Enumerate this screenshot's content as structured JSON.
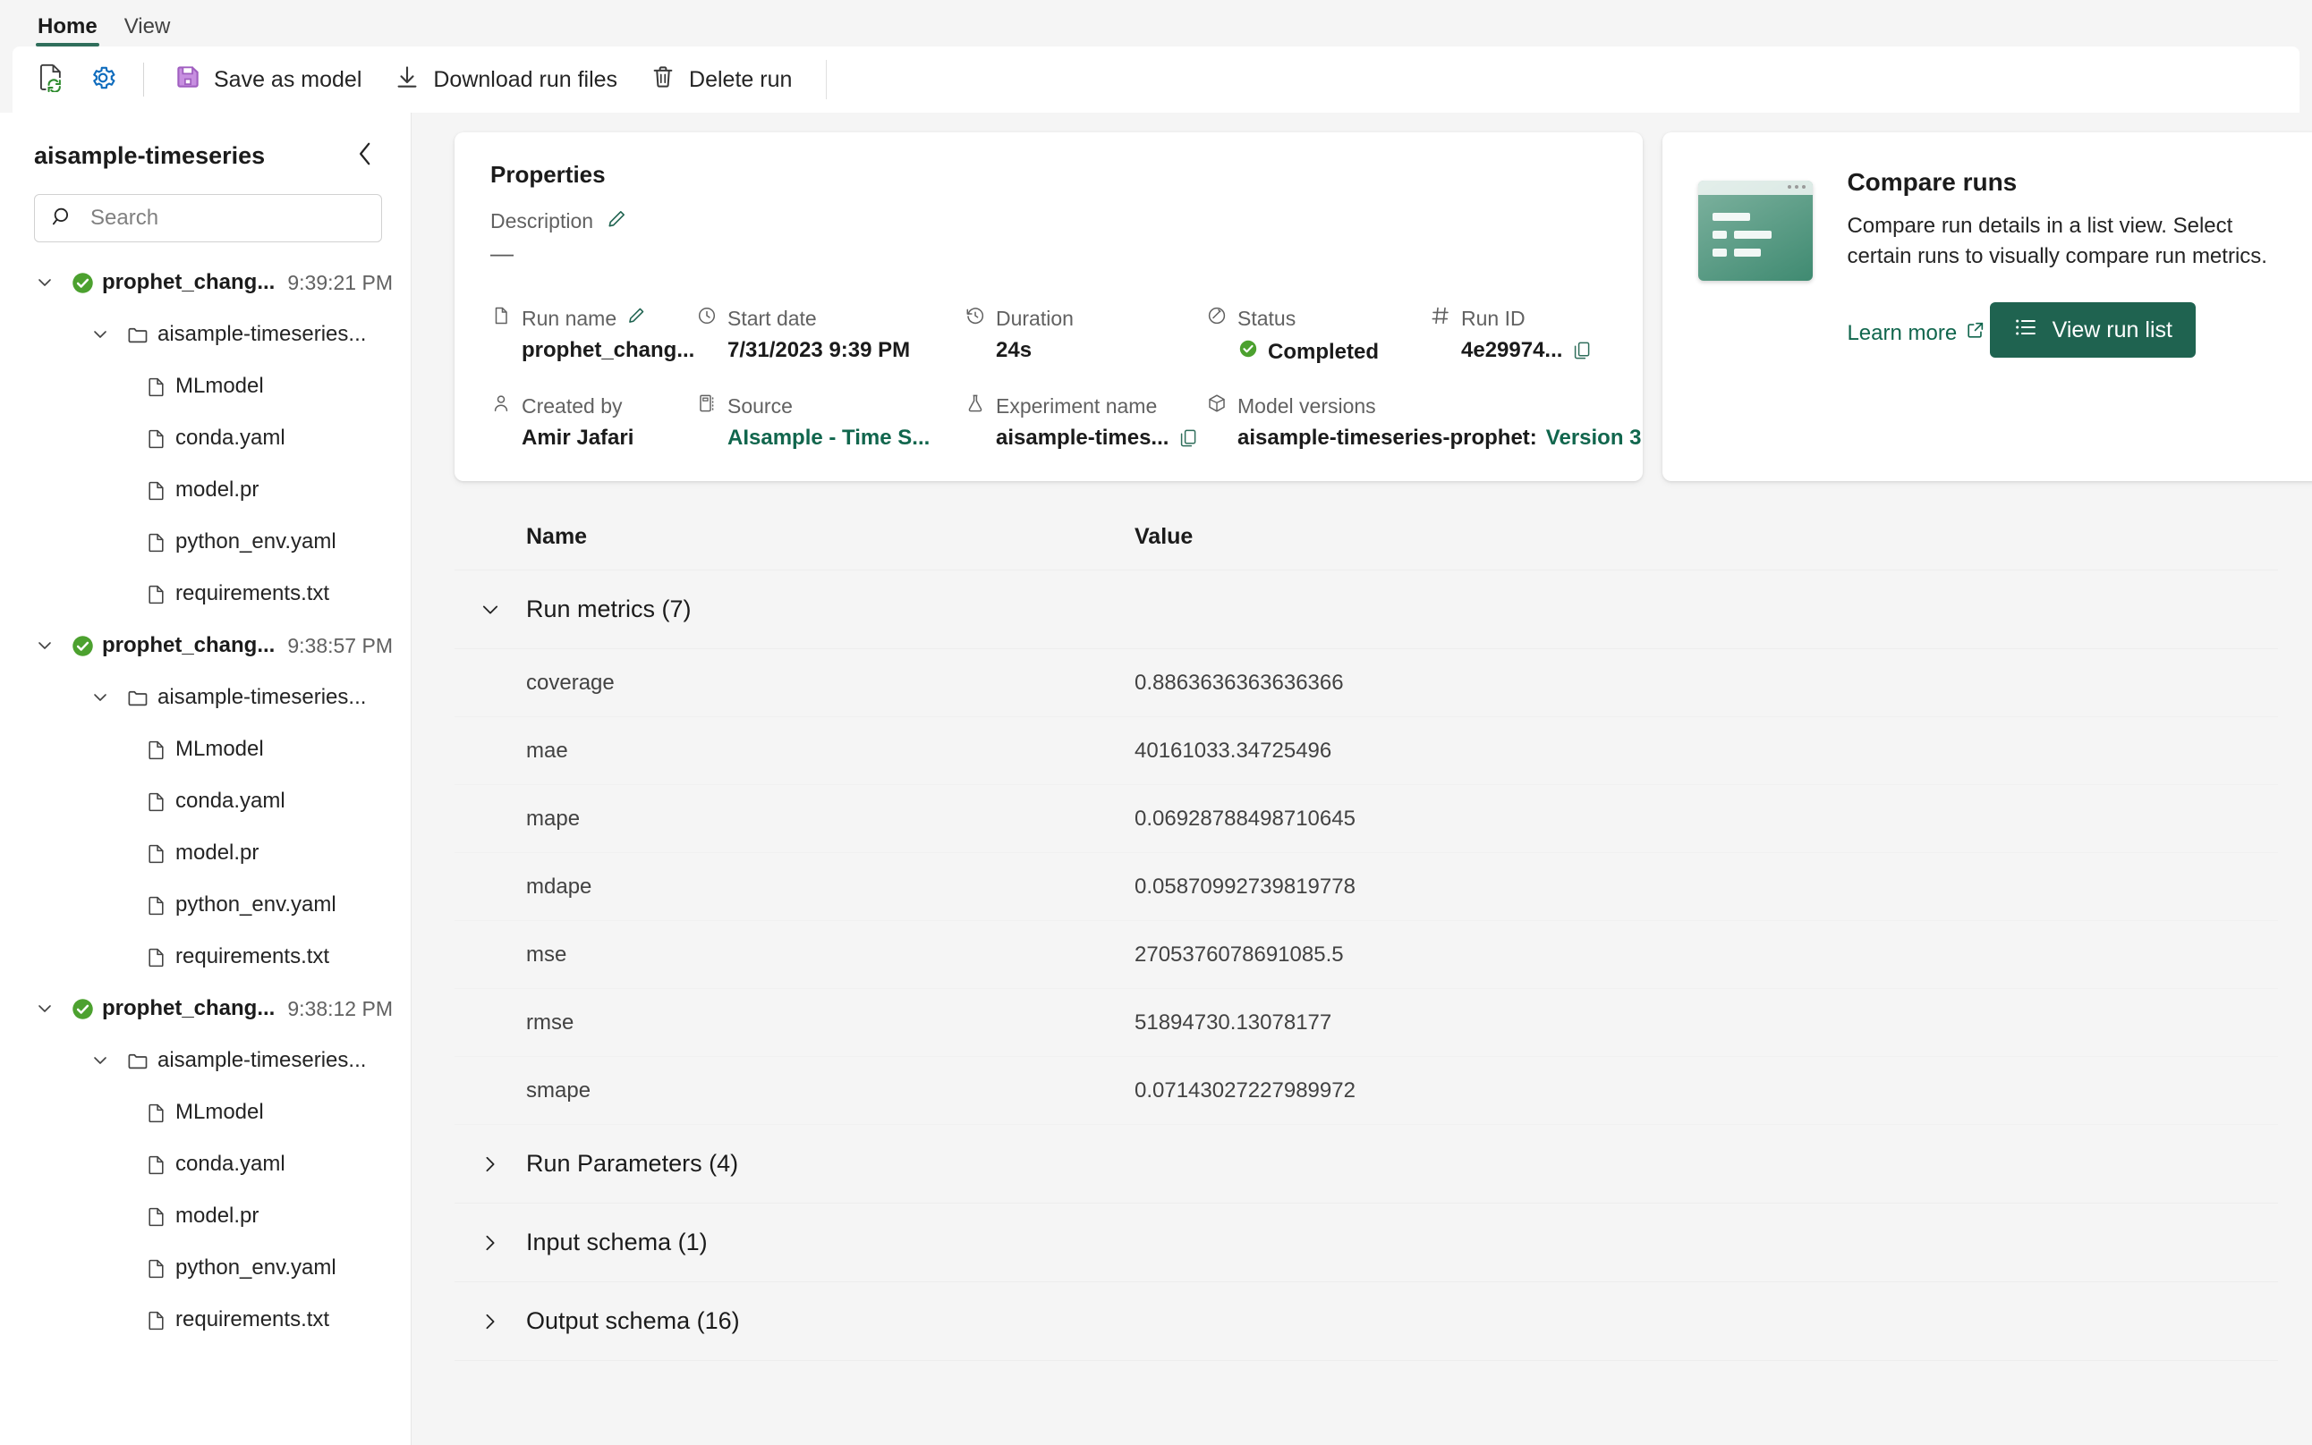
{
  "ribbon": {
    "tabs": [
      {
        "label": "Home",
        "active": true
      },
      {
        "label": "View",
        "active": false
      }
    ],
    "icon_buttons": [
      {
        "name": "refresh-document-icon"
      },
      {
        "name": "settings-gear-icon"
      }
    ],
    "buttons": [
      {
        "label": "Save as model",
        "icon": "save-floppy-icon"
      },
      {
        "label": "Download run files",
        "icon": "download-arrow-icon"
      },
      {
        "label": "Delete run",
        "icon": "trash-icon"
      }
    ]
  },
  "sidebar": {
    "title": "aisample-timeseries",
    "collapse_icon": "chevron-left-icon",
    "search": {
      "placeholder": "Search",
      "value": ""
    },
    "runs": [
      {
        "label": "prophet_chang...",
        "time": "9:39:21 PM",
        "status_icon": "check-circle-icon",
        "folder": "aisample-timeseries...",
        "files": [
          "MLmodel",
          "conda.yaml",
          "model.pr",
          "python_env.yaml",
          "requirements.txt"
        ]
      },
      {
        "label": "prophet_chang...",
        "time": "9:38:57 PM",
        "status_icon": "check-circle-icon",
        "folder": "aisample-timeseries...",
        "files": [
          "MLmodel",
          "conda.yaml",
          "model.pr",
          "python_env.yaml",
          "requirements.txt"
        ]
      },
      {
        "label": "prophet_chang...",
        "time": "9:38:12 PM",
        "status_icon": "check-circle-icon",
        "folder": "aisample-timeseries...",
        "files": [
          "MLmodel",
          "conda.yaml",
          "model.pr",
          "python_env.yaml",
          "requirements.txt"
        ]
      }
    ]
  },
  "properties": {
    "title": "Properties",
    "description_label": "Description",
    "description_value": "—",
    "edit_icon": "pencil-icon",
    "fields": [
      {
        "label": "Run name",
        "value": "prophet_chang...",
        "icon": "document-icon",
        "edit": true,
        "link": false,
        "copy": false
      },
      {
        "label": "Start date",
        "value": "7/31/2023 9:39 PM",
        "icon": "clock-icon",
        "edit": false,
        "link": false,
        "copy": false
      },
      {
        "label": "Duration",
        "value": "24s",
        "icon": "history-icon",
        "edit": false,
        "link": false,
        "copy": false
      },
      {
        "label": "Status",
        "value": "Completed",
        "icon": "status-icon",
        "edit": false,
        "link": false,
        "copy": false,
        "status": true
      },
      {
        "label": "Run ID",
        "value": "4e29974...",
        "icon": "hash-icon",
        "edit": false,
        "link": false,
        "copy": true
      },
      {
        "label": "Created by",
        "value": "Amir Jafari",
        "icon": "person-icon",
        "edit": false,
        "link": false,
        "copy": false
      },
      {
        "label": "Source",
        "value": "AIsample - Time S...",
        "icon": "notebook-icon",
        "edit": false,
        "link": true,
        "copy": false
      },
      {
        "label": "Experiment name",
        "value": "aisample-times...",
        "icon": "flask-icon",
        "edit": false,
        "link": false,
        "copy": true
      },
      {
        "label": "Model versions",
        "value": "aisample-timeseries-prophet: ",
        "version": "Version 3",
        "icon": "cube-icon",
        "edit": false,
        "link": false,
        "copy": false
      }
    ]
  },
  "compare": {
    "title": "Compare runs",
    "description": "Compare run details in a list view. Select certain runs to visually compare run metrics.",
    "learn_more": "Learn more",
    "learn_more_icon": "external-link-icon",
    "button_label": "View run list",
    "button_icon": "list-icon",
    "thumb_icon": "window-list-thumbnail",
    "accent_color": "#1f6350"
  },
  "table": {
    "columns": {
      "name": "Name",
      "value": "Value"
    },
    "sections": [
      {
        "label": "Run metrics (7)",
        "expanded": true,
        "chevron": "chevron-down-icon"
      },
      {
        "label": "Run Parameters (4)",
        "expanded": false,
        "chevron": "chevron-right-icon"
      },
      {
        "label": "Input schema (1)",
        "expanded": false,
        "chevron": "chevron-right-icon"
      },
      {
        "label": "Output schema (16)",
        "expanded": false,
        "chevron": "chevron-right-icon"
      }
    ],
    "metrics": [
      {
        "name": "coverage",
        "value": "0.8863636363636366"
      },
      {
        "name": "mae",
        "value": "40161033.34725496"
      },
      {
        "name": "mape",
        "value": "0.06928788498710645"
      },
      {
        "name": "mdape",
        "value": "0.05870992739819778"
      },
      {
        "name": "mse",
        "value": "2705376078691085.5"
      },
      {
        "name": "rmse",
        "value": "51894730.13078177"
      },
      {
        "name": "smape",
        "value": "0.07143027227989972"
      }
    ]
  }
}
